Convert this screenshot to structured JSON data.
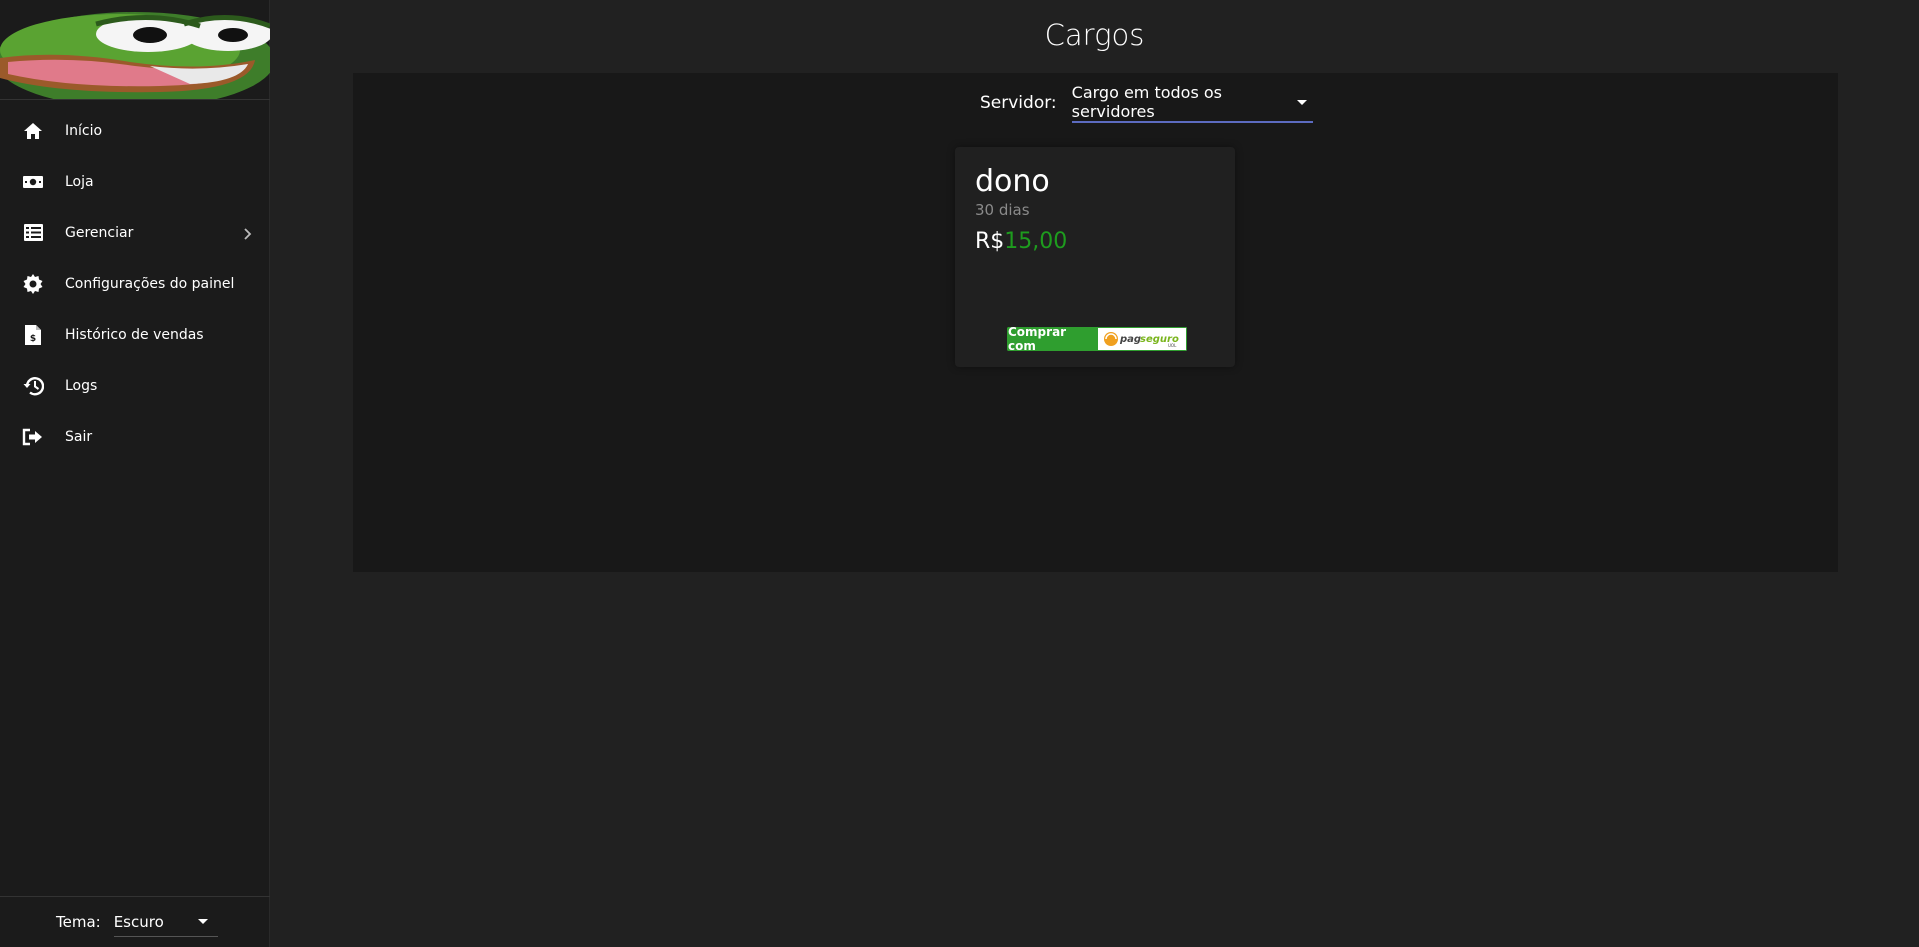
{
  "sidebar": {
    "items": [
      {
        "label": "Início",
        "icon": "home-icon"
      },
      {
        "label": "Loja",
        "icon": "money-icon"
      },
      {
        "label": "Gerenciar",
        "icon": "list-icon",
        "has_submenu": true
      },
      {
        "label": "Configurações do painel",
        "icon": "gear-icon"
      },
      {
        "label": "Histórico de vendas",
        "icon": "invoice-icon"
      },
      {
        "label": "Logs",
        "icon": "history-icon"
      },
      {
        "label": "Sair",
        "icon": "logout-icon"
      }
    ],
    "theme": {
      "label": "Tema:",
      "value": "Escuro"
    }
  },
  "main": {
    "title": "Cargos",
    "server": {
      "label": "Servidor:",
      "value": "Cargo em todos os servidores"
    },
    "cards": [
      {
        "title": "dono",
        "duration": "30 dias",
        "currency": "R$",
        "price": "15,00",
        "buy_label": "Comprar com",
        "payment_logo": "pagseguro-logo"
      }
    ]
  },
  "colors": {
    "background": "#212121",
    "sidebar": "#1b1b1b",
    "panel": "#181818",
    "card": "#202020",
    "price_green": "#1e9c1e",
    "select_underline": "#5c6bc0",
    "buy_green": "#2f9e2f"
  }
}
